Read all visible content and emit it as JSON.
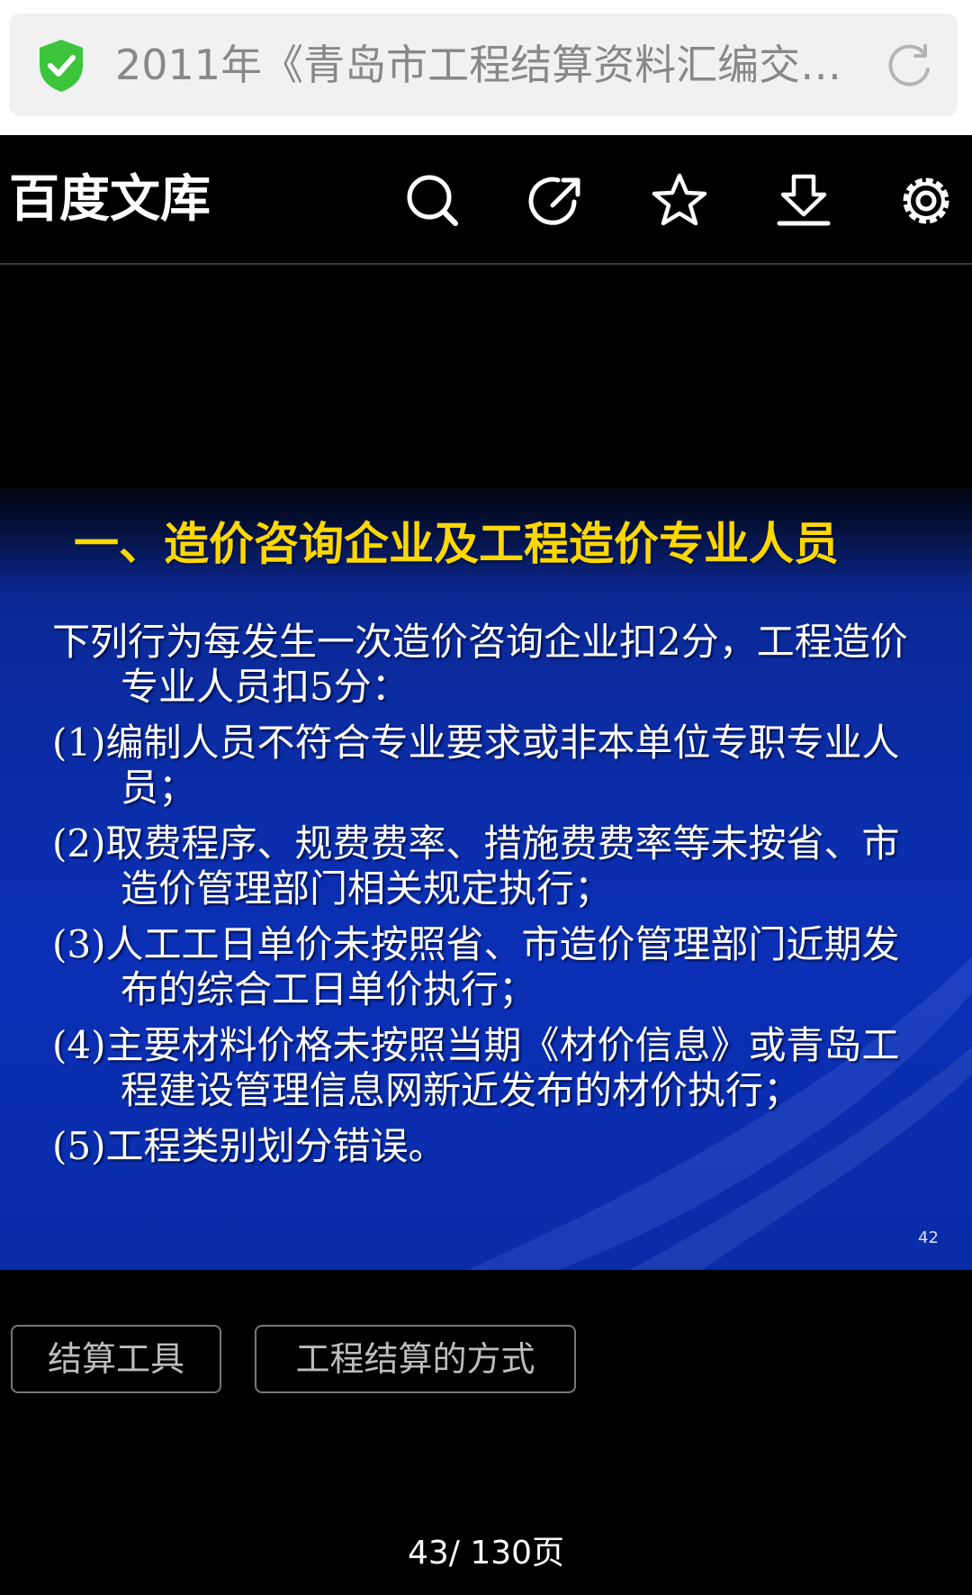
{
  "address_bar": {
    "title": "2011年《青岛市工程结算资料汇编交…",
    "security_status_color": "#3cc43c",
    "icons": [
      "shield-check-icon",
      "reload-icon"
    ]
  },
  "app_header": {
    "brand": "百度文库",
    "icons": [
      "search-icon",
      "share-icon",
      "star-icon",
      "download-icon",
      "gear-icon"
    ]
  },
  "slide": {
    "title": "一、造价咨询企业及工程造价专业人员",
    "paragraphs": [
      "下列行为每发生一次造价咨询企业扣2分，工程造价专业人员扣5分：",
      "(1)编制人员不符合专业要求或非本单位专职专业人员；",
      "(2)取费程序、规费费率、措施费费率等未按省、市造价管理部门相关规定执行；",
      "(3)人工工日单价未按照省、市造价管理部门近期发布的综合工日单价执行；",
      "(4)主要材料价格未按照当期《材价信息》或青岛工程建设管理信息网新近发布的材价执行；",
      "(5)工程类别划分错误。"
    ],
    "page_number": "42",
    "colors": {
      "background": "#0b30b6",
      "title": "#ffd700",
      "text": "#ffffff"
    }
  },
  "tags": [
    "结算工具",
    "工程结算的方式"
  ],
  "pager": {
    "label": "43/ 130页"
  }
}
